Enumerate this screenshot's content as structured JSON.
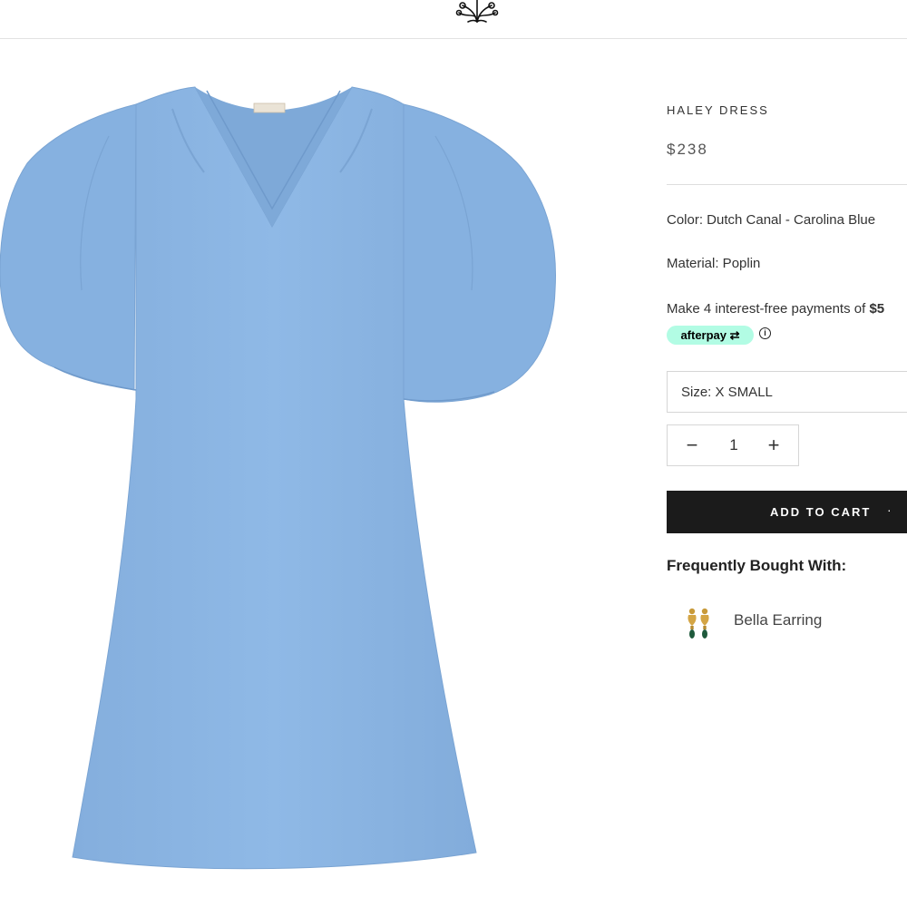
{
  "product": {
    "title": "HALEY DRESS",
    "price": "$238",
    "color_line": "Color: Dutch Canal - Carolina Blue",
    "material_line": "Material: Poplin",
    "installment_text": "Make 4 interest-free payments of ",
    "installment_amount": "$5",
    "afterpay_label": "afterpay",
    "info_glyph": "i",
    "size_label": "Size: X SMALL",
    "quantity": "1",
    "qty_minus": "−",
    "qty_plus": "+",
    "add_to_cart_label": "ADD TO CART",
    "add_to_cart_separator": "·",
    "dress_color": "#8cb6e4"
  },
  "frequently_bought": {
    "heading": "Frequently Bought With:",
    "items": [
      {
        "name": "Bella Earring",
        "icon": "earring-icon"
      }
    ]
  },
  "header": {
    "logo_icon": "tree-logo-icon"
  },
  "colors": {
    "button_bg": "#1b1b1b",
    "afterpay_mint": "#b2fce4",
    "divider": "#dedede"
  }
}
